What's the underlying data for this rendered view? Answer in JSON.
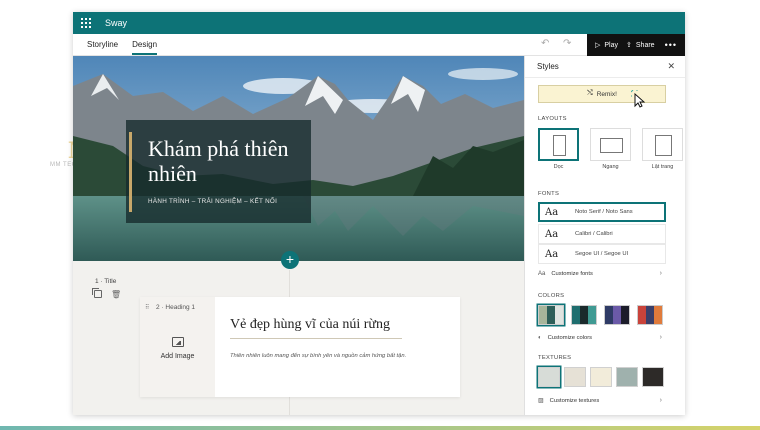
{
  "watermark": {
    "mark": "M",
    "text": "MM TECHNOLOGY"
  },
  "app": {
    "name": "Sway"
  },
  "toolbar": {
    "tabs": [
      {
        "label": "Storyline",
        "active": false
      },
      {
        "label": "Design",
        "active": true
      }
    ],
    "play_label": "Play",
    "share_label": "Share",
    "undo_icon": "undo-icon",
    "redo_icon": "redo-icon",
    "more_icon": "more-icon"
  },
  "hero": {
    "title": "Khám phá thiên nhiên",
    "subtitle": "HÀNH TRÌNH – TRẢI NGHIỆM – KẾT NỐI"
  },
  "card1": {
    "number": "1",
    "label": "Title"
  },
  "card2": {
    "number": "2",
    "type": "Heading 1",
    "add_image_label": "Add Image",
    "heading": "Vẻ đẹp hùng vĩ của núi rừng",
    "body": "Thiên nhiên luôn mang đến sự bình yên và nguồn cảm hứng bất tận."
  },
  "styles_panel": {
    "title": "Styles",
    "remix_label": "Remix!",
    "layouts_heading": "LAYOUTS",
    "layouts": [
      {
        "label": "Dọc",
        "selected": true
      },
      {
        "label": "Ngang",
        "selected": false
      },
      {
        "label": "Lật trang",
        "selected": false
      }
    ],
    "fonts_heading": "FONTS",
    "fonts": [
      {
        "sample": "Aa",
        "name": "Noto Serif / Noto Sans",
        "selected": true
      },
      {
        "sample": "Aa",
        "name": "Calibri / Calibri",
        "selected": false
      },
      {
        "sample": "Aa",
        "name": "Segoe UI / Segoe UI",
        "selected": false
      }
    ],
    "customize_fonts": "Customize fonts",
    "colors_heading": "COLORS",
    "color_palettes": [
      {
        "colors": [
          "#a7b59a",
          "#2e5e58",
          "#dfe4e0"
        ],
        "selected": true
      },
      {
        "colors": [
          "#1f6e6f",
          "#1a2a2c",
          "#3f9a93"
        ],
        "selected": false
      },
      {
        "colors": [
          "#2f3b66",
          "#6b5aa8",
          "#1c1c2a"
        ],
        "selected": false
      },
      {
        "colors": [
          "#c9433b",
          "#3a3f6a",
          "#e07b3c"
        ],
        "selected": false
      }
    ],
    "customize_colors": "Customize colors",
    "textures_heading": "TEXTURES",
    "textures": [
      {
        "color": "#d7dcd7",
        "selected": true
      },
      {
        "color": "#e6e1d6",
        "selected": false
      },
      {
        "color": "#f2ecda",
        "selected": false
      },
      {
        "color": "#9fb1ad",
        "selected": false
      },
      {
        "color": "#2d2a28",
        "selected": false
      }
    ],
    "customize_textures": "Customize textures"
  },
  "colors": {
    "accent": "#0d7377",
    "remix_bg": "#faf3d2",
    "hero_bar": "#c8a86a"
  }
}
